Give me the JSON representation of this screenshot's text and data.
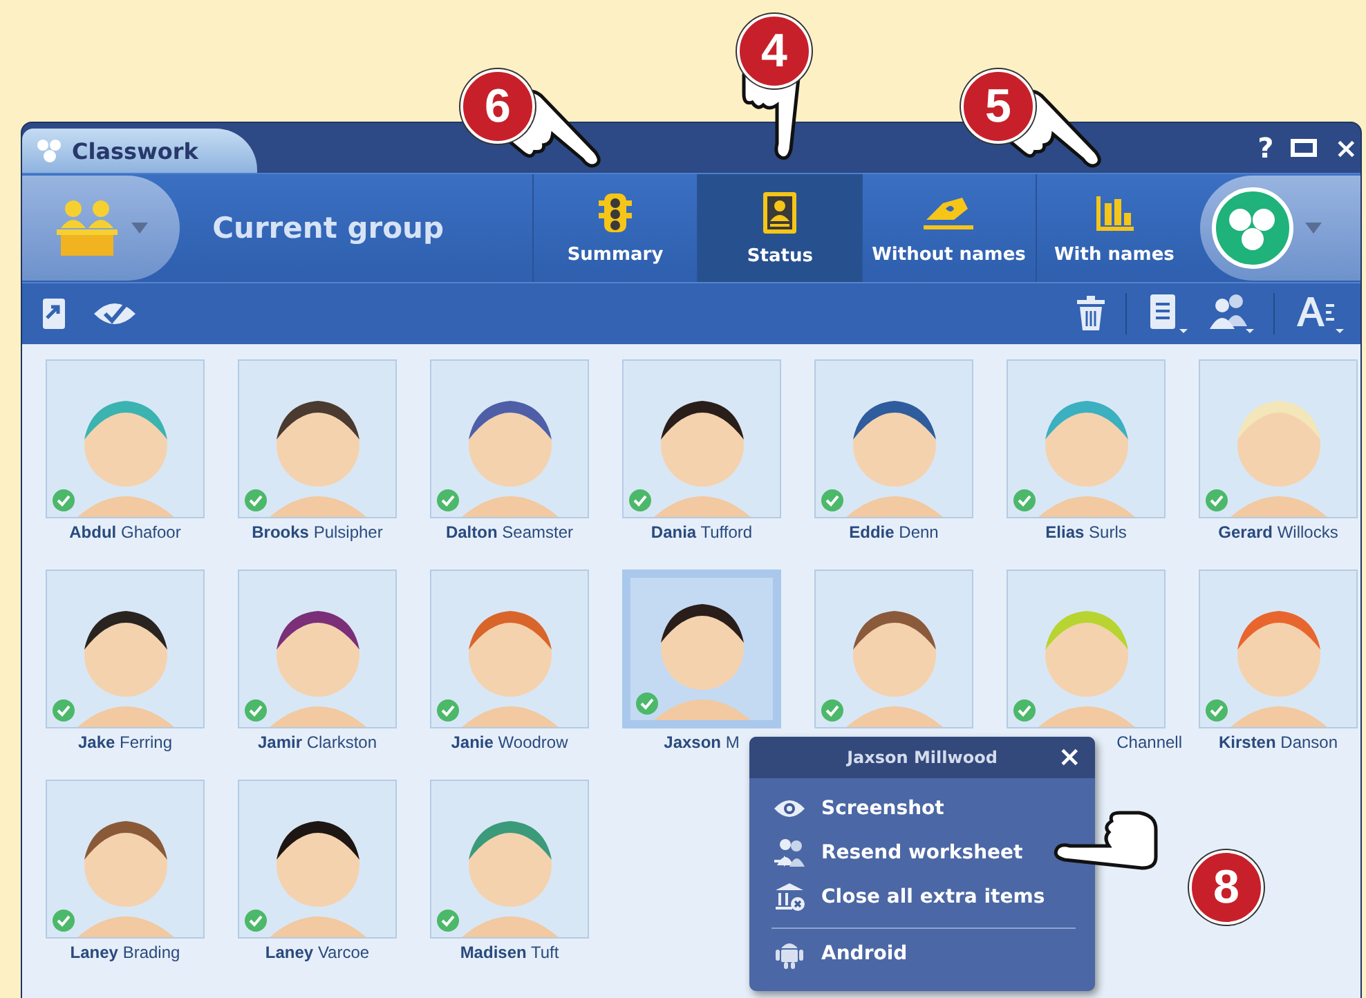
{
  "window": {
    "title": "Classwork",
    "controls": [
      "?",
      "×"
    ]
  },
  "toolbar": {
    "group_label": "Current group",
    "buttons": [
      {
        "label": "Summary",
        "kind": "traffic",
        "selected": false
      },
      {
        "label": "Status",
        "kind": "status",
        "selected": true
      },
      {
        "label": "Without names",
        "kind": "hand",
        "selected": false
      },
      {
        "label": "With names",
        "kind": "bars",
        "selected": false
      }
    ]
  },
  "students": [
    {
      "first": "Abdul",
      "last": "Ghafoor",
      "checked": true,
      "selected": false,
      "color": "#3bb3b0"
    },
    {
      "first": "Brooks",
      "last": "Pulsipher",
      "checked": true,
      "selected": false,
      "color": "#4a3a30"
    },
    {
      "first": "Dalton",
      "last": "Seamster",
      "checked": true,
      "selected": false,
      "color": "#4e5fa8"
    },
    {
      "first": "Dania",
      "last": "Tufford",
      "checked": true,
      "selected": false,
      "color": "#2a1e1a"
    },
    {
      "first": "Eddie",
      "last": "Denn",
      "checked": true,
      "selected": false,
      "color": "#2f5c9c"
    },
    {
      "first": "Elias",
      "last": "Surls",
      "checked": true,
      "selected": false,
      "color": "#3ab0c0"
    },
    {
      "first": "Gerard",
      "last": "Willocks",
      "checked": true,
      "selected": false,
      "color": "#f3e6b8"
    },
    {
      "first": "Jake",
      "last": "Ferring",
      "checked": true,
      "selected": false,
      "color": "#2a2420"
    },
    {
      "first": "Jamir",
      "last": "Clarkston",
      "checked": true,
      "selected": false,
      "color": "#7a2f78"
    },
    {
      "first": "Janie",
      "last": "Woodrow",
      "checked": true,
      "selected": false,
      "color": "#d9652a"
    },
    {
      "first": "Jaxson",
      "last": "M",
      "checked": true,
      "selected": true,
      "color": "#2a1e1a"
    },
    {
      "checked": true,
      "selected": false,
      "color": "#8a5a3a"
    },
    {
      "last": "Channell",
      "checked": true,
      "selected": false,
      "color": "#b8d430"
    },
    {
      "first": "Kirsten",
      "last": "Danson",
      "checked": true,
      "selected": false,
      "color": "#e8662e"
    },
    {
      "first": "Laney",
      "last": "Brading",
      "checked": true,
      "selected": false,
      "color": "#8a5a38"
    },
    {
      "first": "Laney",
      "last": "Varcoe",
      "checked": true,
      "selected": false,
      "color": "#1e1612"
    },
    {
      "first": "Madisen",
      "last": "Tuft",
      "checked": true,
      "selected": false,
      "color": "#3a9a7a"
    }
  ],
  "popup": {
    "title": "Jaxson Millwood",
    "close": "×",
    "items": [
      {
        "label": "Screenshot",
        "kind": "eye",
        "separator": false
      },
      {
        "label": "Resend worksheet",
        "kind": "people",
        "separator": false
      },
      {
        "label": "Close all extra items",
        "kind": "close-items",
        "separator": false
      },
      {
        "label": "Android",
        "kind": "android",
        "separator": true
      }
    ]
  },
  "callouts": [
    {
      "number": "6"
    },
    {
      "number": "4"
    },
    {
      "number": "5"
    },
    {
      "number": "8"
    }
  ]
}
